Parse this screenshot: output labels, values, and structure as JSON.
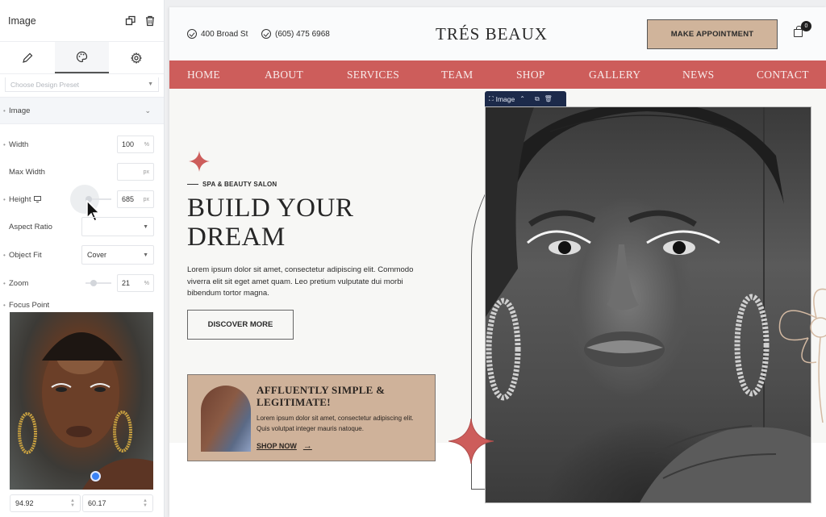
{
  "panel": {
    "title": "Image",
    "header_icons": [
      "duplicate-icon",
      "trash-icon"
    ],
    "tabs": [
      {
        "name": "content",
        "icon": "pencil-icon",
        "active": false
      },
      {
        "name": "style",
        "icon": "palette-icon",
        "active": true
      },
      {
        "name": "advanced",
        "icon": "gear-icon",
        "active": false
      }
    ],
    "design_preset_placeholder": "Choose Design Preset",
    "section_title": "Image",
    "fields": {
      "width": {
        "label": "Width",
        "value": "100",
        "unit": "%"
      },
      "max_width": {
        "label": "Max Width",
        "value": "",
        "unit": "px"
      },
      "height": {
        "label": "Height",
        "value": "685",
        "unit": "px",
        "device_icon": "desktop-icon"
      },
      "aspect_ratio": {
        "label": "Aspect Ratio",
        "value": ""
      },
      "object_fit": {
        "label": "Object Fit",
        "value": "Cover"
      },
      "zoom": {
        "label": "Zoom",
        "value": "21",
        "unit": "%"
      },
      "focus_point": {
        "label": "Focus Point",
        "x": "94.92",
        "y": "60.17"
      }
    }
  },
  "site": {
    "address": "400 Broad St",
    "phone": "(605) 475 6968",
    "brand": "TRÉS BEAUX",
    "cta": "MAKE APPOINTMENT",
    "cart_count": "0",
    "nav": [
      "HOME",
      "ABOUT",
      "SERVICES",
      "TEAM",
      "SHOP",
      "GALLERY",
      "NEWS",
      "CONTACT"
    ],
    "hero": {
      "kicker": "SPA & BEAUTY SALON",
      "headline_line1": "BUILD YOUR",
      "headline_line2": "DREAM",
      "paragraph": "Lorem ipsum dolor sit amet, consectetur adipiscing elit. Commodo viverra elit sit eget amet quam. Leo pretium vulputate dui morbi bibendum tortor magna.",
      "button": "DISCOVER MORE"
    },
    "promo": {
      "title_line1": "AFFLUENTLY SIMPLE &",
      "title_line2": "LEGITIMATE!",
      "text": "Lorem ipsum dolor sit amet, consectetur adipiscing elit. Quis volutpat integer mauris natoque.",
      "link": "SHOP NOW"
    },
    "selected_element_toolbar": {
      "label": "Image"
    },
    "colors": {
      "accent": "#cd5d5b",
      "tan": "#d0b49b",
      "toolbar": "#1c2a4a",
      "focus_dot": "#3a82f6"
    }
  }
}
